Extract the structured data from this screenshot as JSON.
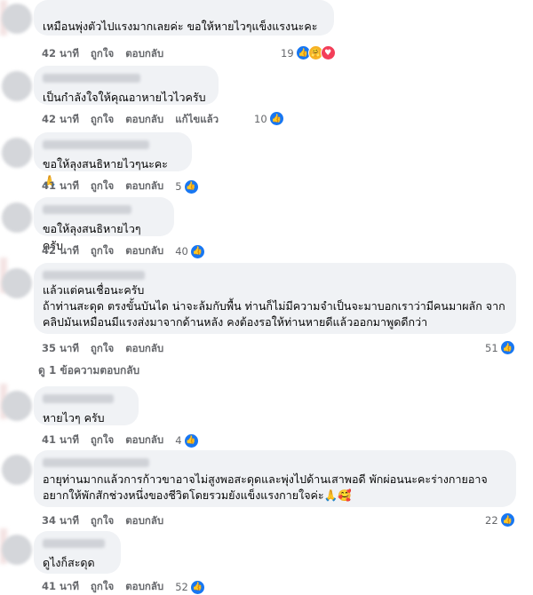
{
  "comments": [
    {
      "text": "เหมือนพุ่งตัวไปแรงมากเลยค่ะ ขอให้หายไวๆแข็งแรงนะคะ",
      "time": "42 นาที",
      "like": "ถูกใจ",
      "reply": "ตอบกลับ",
      "reactions": "19"
    },
    {
      "text": "เป็นกำลังใจให้คุณอาหายไวไวครับ",
      "time": "42 นาที",
      "like": "ถูกใจ",
      "reply": "ตอบกลับ",
      "edited": "แก้ไขแล้ว",
      "reactions": "10"
    },
    {
      "text": "ขอให้ลุงสนธิหายไวๆนะคะ🙏",
      "time": "41 นาที",
      "like": "ถูกใจ",
      "reply": "ตอบกลับ",
      "reactions": "5"
    },
    {
      "text": "ขอให้ลุงสนธิหายไวๆ ครับ",
      "time": "42 นาที",
      "like": "ถูกใจ",
      "reply": "ตอบกลับ",
      "reactions": "40"
    },
    {
      "text": "แล้วแต่คนเชื่อนะครับ\nถ้าท่านสะดุด ตรงขั้นบันได น่าจะล้มกับพื้น ท่านก็ไม่มีความจำเป็นจะมาบอกเราว่ามีคนมาผลัก จาก\nคลิปมันเหมือนมีแรงส่งมาจากด้านหลัง คงต้องรอให้ท่านหายดีแล้วออกมาพูดดีกว่า",
      "time": "35 นาที",
      "like": "ถูกใจ",
      "reply": "ตอบกลับ",
      "reactions": "51",
      "view_replies": "ดู 1 ข้อความตอบกลับ"
    },
    {
      "text": "หายไวๆ ครับ",
      "time": "41 นาที",
      "like": "ถูกใจ",
      "reply": "ตอบกลับ",
      "reactions": "4"
    },
    {
      "text": "อายุท่านมากแล้วการก้าวขาอาจไม่สูงพอสะดุดและพุ่งไปด้านเสาพอดี พักผ่อนนะคะร่างกายอาจ\nอยากให้พักสักช่วงหนึ่งของชีวิตโดยรวมยังแข็งแรงกายใจค่ะ🙏🥰",
      "time": "34 นาที",
      "like": "ถูกใจ",
      "reply": "ตอบกลับ",
      "reactions": "22"
    },
    {
      "text": "ดูไงก็สะดุด",
      "time": "41 นาที",
      "like": "ถูกใจ",
      "reply": "ตอบกลับ",
      "reactions": "52"
    }
  ],
  "colors": {
    "like_blue": "#1877f2",
    "bubble": "#f0f2f5",
    "meta": "#65676b"
  }
}
